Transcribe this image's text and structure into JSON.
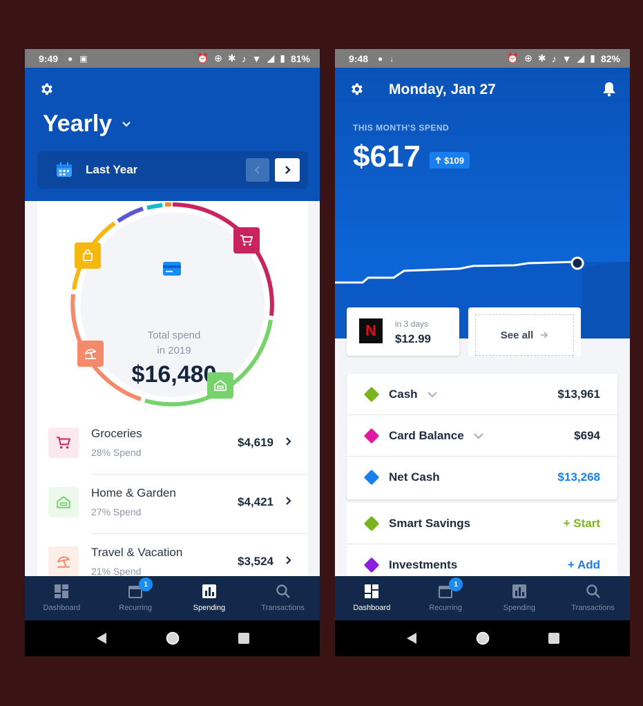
{
  "colors": {
    "header_blue": "#0a52b8",
    "header_blue_right": "#0a5fd1",
    "nav_bg": "#13294b",
    "groceries": "#c8245e",
    "home_garden": "#76d26b",
    "travel": "#f38a6a",
    "shopping": "#f6b70f",
    "cash": "#7cb41f",
    "card_balance": "#e21aa3",
    "net_cash": "#1a7fee",
    "smart_savings": "#7cb41f",
    "investments": "#8a1ee0"
  },
  "left": {
    "status": {
      "time": "9:49",
      "battery": "81%"
    },
    "header": {
      "title": "Yearly",
      "period": "Last Year"
    },
    "summary": {
      "label_line1": "Total spend",
      "label_line2": "in 2019",
      "value": "$16,480"
    },
    "categories": [
      {
        "name": "Groceries",
        "sub": "28% Spend",
        "amount": "$4,619",
        "icon": "cart-icon"
      },
      {
        "name": "Home & Garden",
        "sub": "27% Spend",
        "amount": "$4,421",
        "icon": "house-icon"
      },
      {
        "name": "Travel & Vacation",
        "sub": "21% Spend",
        "amount": "$3,524",
        "icon": "beach-icon"
      }
    ],
    "nav": [
      {
        "label": "Dashboard",
        "icon": "dashboard-icon",
        "active": false
      },
      {
        "label": "Recurring",
        "icon": "calendar-icon",
        "active": false,
        "badge": "1"
      },
      {
        "label": "Spending",
        "icon": "bar-chart-icon",
        "active": true
      },
      {
        "label": "Transactions",
        "icon": "search-icon",
        "active": false
      }
    ]
  },
  "right": {
    "status": {
      "time": "9:48",
      "battery": "82%"
    },
    "header": {
      "date": "Monday, Jan 27",
      "spend_label": "THIS MONTH'S SPEND",
      "spend_value": "$617",
      "spend_delta": "$109"
    },
    "bill": {
      "due": "in 3 days",
      "amount": "$12.99",
      "logo": "N"
    },
    "see_all": "See all",
    "accounts": [
      {
        "name": "Cash",
        "value": "$13,961",
        "dropdown": true
      },
      {
        "name": "Card Balance",
        "value": "$694",
        "dropdown": true
      },
      {
        "name": "Net Cash",
        "value": "$13,268",
        "dropdown": false
      }
    ],
    "extras": [
      {
        "name": "Smart Savings",
        "action": "+ Start"
      },
      {
        "name": "Investments",
        "action": "+ Add"
      }
    ],
    "nav": [
      {
        "label": "Dashboard",
        "icon": "dashboard-icon",
        "active": true
      },
      {
        "label": "Recurring",
        "icon": "calendar-icon",
        "active": false,
        "badge": "1"
      },
      {
        "label": "Spending",
        "icon": "bar-chart-icon",
        "active": false
      },
      {
        "label": "Transactions",
        "icon": "search-icon",
        "active": false
      }
    ]
  }
}
